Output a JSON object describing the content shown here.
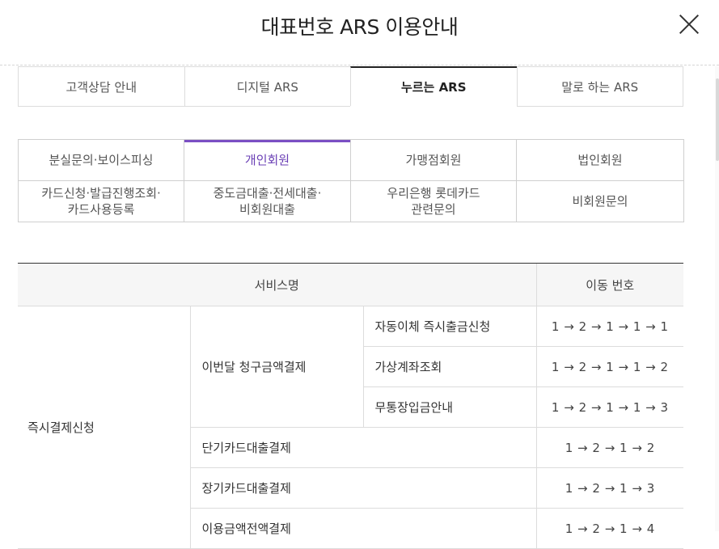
{
  "header": {
    "title": "대표번호 ARS 이용안내",
    "close_icon": "close-icon"
  },
  "main_tabs": [
    {
      "label": "고객상담 안내",
      "active": false
    },
    {
      "label": "디지털 ARS",
      "active": false
    },
    {
      "label": "누르는 ARS",
      "active": true
    },
    {
      "label": "말로 하는 ARS",
      "active": false
    }
  ],
  "sub_tabs": [
    {
      "label": "분실문의·보이스피싱",
      "active": false
    },
    {
      "label": "개인회원",
      "active": true
    },
    {
      "label": "가맹점회원",
      "active": false
    },
    {
      "label": "법인회원",
      "active": false
    },
    {
      "label": "카드신청·발급진행조회·\n카드사용등록",
      "active": false
    },
    {
      "label": "중도금대출·전세대출·\n비회원대출",
      "active": false
    },
    {
      "label": "우리은행 롯데카드\n관련문의",
      "active": false
    },
    {
      "label": "비회원문의",
      "active": false
    }
  ],
  "colors": {
    "accent": "#7b4fc4",
    "accent_text": "#6a3fb5"
  },
  "table": {
    "headers": {
      "service": "서비스명",
      "number": "이동 번호"
    },
    "group": "즉시결제신청",
    "sub_group": "이번달 청구금액결제",
    "rows": [
      {
        "service": "자동이체 즉시출금신청",
        "number": "1 → 2 → 1 → 1 → 1"
      },
      {
        "service": "가상계좌조회",
        "number": "1 → 2 → 1 → 1 → 2"
      },
      {
        "service": "무통장입금안내",
        "number": "1 → 2 → 1 → 1 → 3"
      },
      {
        "service": "단기카드대출결제",
        "number": "1 → 2 → 1 → 2"
      },
      {
        "service": "장기카드대출결제",
        "number": "1 → 2 → 1 → 3"
      },
      {
        "service": "이용금액전액결제",
        "number": "1 → 2 → 1 → 4"
      }
    ]
  }
}
